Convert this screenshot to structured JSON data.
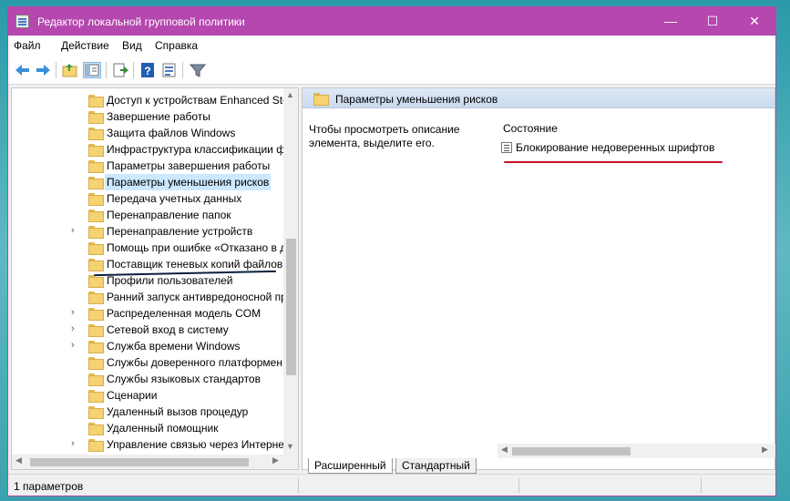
{
  "window": {
    "title": "Редактор локальной групповой политики",
    "controls": {
      "minimize": "—",
      "maximize": "☐",
      "close": "✕"
    }
  },
  "menu": [
    "Файл",
    "Действие",
    "Вид",
    "Справка"
  ],
  "toolbar": {
    "icons": [
      "back-arrow-icon",
      "forward-arrow-icon",
      "up-folder-icon",
      "show-hide-tree-icon",
      "export-list-icon",
      "help-icon",
      "properties-icon",
      "filter-icon"
    ]
  },
  "tree": {
    "items": [
      {
        "label": "Доступ к устройствам Enhanced Sto",
        "expander": ""
      },
      {
        "label": "Завершение работы",
        "expander": ""
      },
      {
        "label": "Защита файлов Windows",
        "expander": ""
      },
      {
        "label": "Инфраструктура классификации ф",
        "expander": ""
      },
      {
        "label": "Параметры завершения работы",
        "expander": ""
      },
      {
        "label": "Параметры уменьшения рисков",
        "expander": "",
        "selected": true
      },
      {
        "label": "Передача учетных данных",
        "expander": ""
      },
      {
        "label": "Перенаправление папок",
        "expander": ""
      },
      {
        "label": "Перенаправление устройств",
        "expander": "›"
      },
      {
        "label": "Помощь при ошибке «Отказано в д",
        "expander": ""
      },
      {
        "label": "Поставщик теневых копий файлов",
        "expander": ""
      },
      {
        "label": "Профили пользователей",
        "expander": ""
      },
      {
        "label": "Ранний запуск антивредоносной пр",
        "expander": ""
      },
      {
        "label": "Распределенная модель COM",
        "expander": "›"
      },
      {
        "label": "Сетевой вход в систему",
        "expander": "›"
      },
      {
        "label": "Служба времени Windows",
        "expander": "›"
      },
      {
        "label": "Службы доверенного платформен",
        "expander": ""
      },
      {
        "label": "Службы языковых стандартов",
        "expander": ""
      },
      {
        "label": "Сценарии",
        "expander": ""
      },
      {
        "label": "Удаленный вызов процедур",
        "expander": ""
      },
      {
        "label": "Удаленный помощник",
        "expander": ""
      },
      {
        "label": "Управление связью через Интернет",
        "expander": "›"
      }
    ]
  },
  "details": {
    "header": "Параметры уменьшения рисков",
    "description": "Чтобы просмотреть описание элемента, выделите его.",
    "column_header": "Состояние",
    "settings": [
      "Блокирование недоверенных шрифтов"
    ]
  },
  "tabs": [
    "Расширенный",
    "Стандартный"
  ],
  "status": {
    "text": "1 параметров"
  },
  "colors": {
    "titlebar": "#b547ae",
    "selection": "#cce8ff",
    "annotation_red": "#c8102e"
  }
}
